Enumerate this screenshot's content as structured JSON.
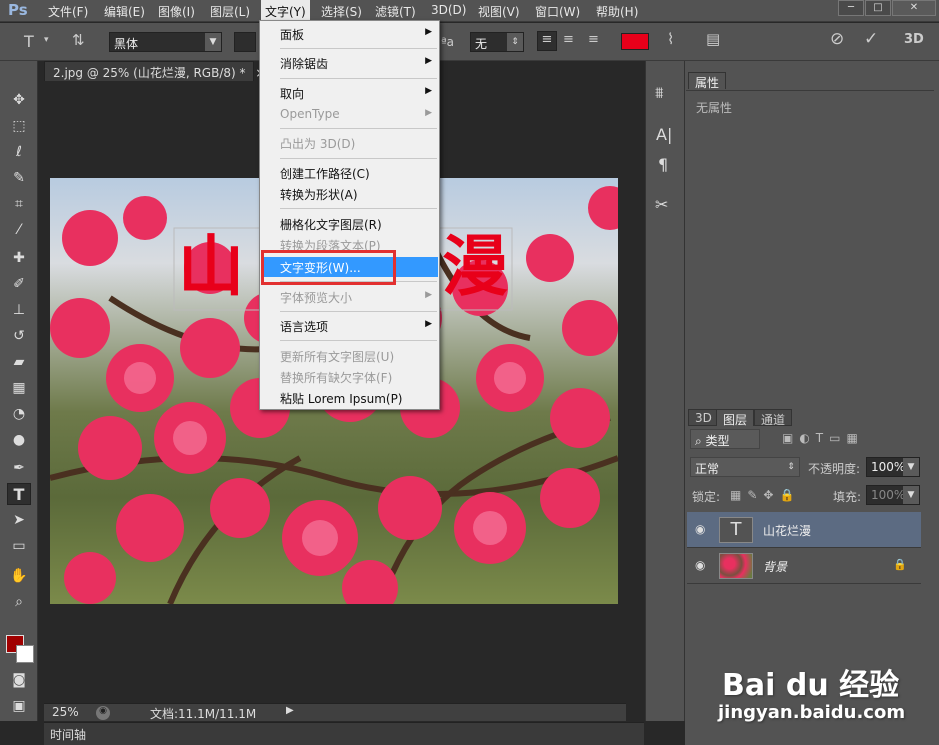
{
  "app": {
    "logo": "Ps"
  },
  "menubar": {
    "items": [
      "文件(F)",
      "编辑(E)",
      "图像(I)",
      "图层(L)",
      "文字(Y)",
      "选择(S)",
      "滤镜(T)",
      "3D(D)",
      "视图(V)",
      "窗口(W)",
      "帮助(H)"
    ],
    "active_item": "文字(Y)",
    "window_buttons": [
      "─",
      "□",
      "✕"
    ]
  },
  "options_bar": {
    "tool_icon": "T",
    "font_family": "黑体",
    "antialias_label": "ªa",
    "antialias_value": "无",
    "text_color": "#e8001a",
    "three_d_label": "3D"
  },
  "document": {
    "tab_title": "2.jpg @ 25% (山花烂漫, RGB/8) *",
    "tab_close": "×",
    "canvas_text": "山花烂漫",
    "canvas_text_color": "#e8001a",
    "zoom": "25%",
    "doc_info": "文档:11.1M/11.1M"
  },
  "type_menu": {
    "items": [
      {
        "label": "面板",
        "submenu": true,
        "disabled": false
      },
      {
        "label": "消除锯齿",
        "submenu": true,
        "disabled": false
      },
      {
        "label": "取向",
        "submenu": true,
        "disabled": false
      },
      {
        "label": "OpenType",
        "submenu": true,
        "disabled": true
      },
      {
        "label": "凸出为 3D(D)",
        "submenu": false,
        "disabled": true
      },
      {
        "label": "创建工作路径(C)",
        "submenu": false,
        "disabled": false
      },
      {
        "label": "转换为形状(A)",
        "submenu": false,
        "disabled": false
      },
      {
        "label": "栅格化文字图层(R)",
        "submenu": false,
        "disabled": false
      },
      {
        "label": "转换为段落文本(P)",
        "submenu": false,
        "disabled": true
      },
      {
        "label": "文字变形(W)...",
        "submenu": false,
        "disabled": false,
        "highlighted": true
      },
      {
        "label": "字体预览大小",
        "submenu": true,
        "disabled": true
      },
      {
        "label": "语言选项",
        "submenu": true,
        "disabled": false
      },
      {
        "label": "更新所有文字图层(U)",
        "submenu": false,
        "disabled": true
      },
      {
        "label": "替换所有缺欠字体(F)",
        "submenu": false,
        "disabled": true
      },
      {
        "label": "粘贴 Lorem Ipsum(P)",
        "submenu": false,
        "disabled": false
      }
    ]
  },
  "properties_panel": {
    "tab": "属性",
    "empty_text": "无属性"
  },
  "layers_panel": {
    "tabs": [
      "3D",
      "图层",
      "通道"
    ],
    "active_tab": "图层",
    "filter_label": "类型",
    "blend_mode": "正常",
    "opacity_label": "不透明度:",
    "opacity_value": "100%",
    "lock_label": "锁定:",
    "fill_label": "填充:",
    "fill_value": "100%",
    "layers": [
      {
        "name": "山花烂漫",
        "type": "text",
        "selected": true,
        "thumb": "T"
      },
      {
        "name": "背景",
        "type": "image",
        "selected": false,
        "locked": true
      }
    ]
  },
  "timeline": {
    "label": "时间轴"
  },
  "watermark": {
    "brand": "Bai du 经验",
    "url": "jingyan.baidu.com"
  },
  "colors": {
    "foreground": "#a00000",
    "background": "#ffffff",
    "menu_highlight": "#3399ff",
    "annotation_box": "#e23030"
  }
}
